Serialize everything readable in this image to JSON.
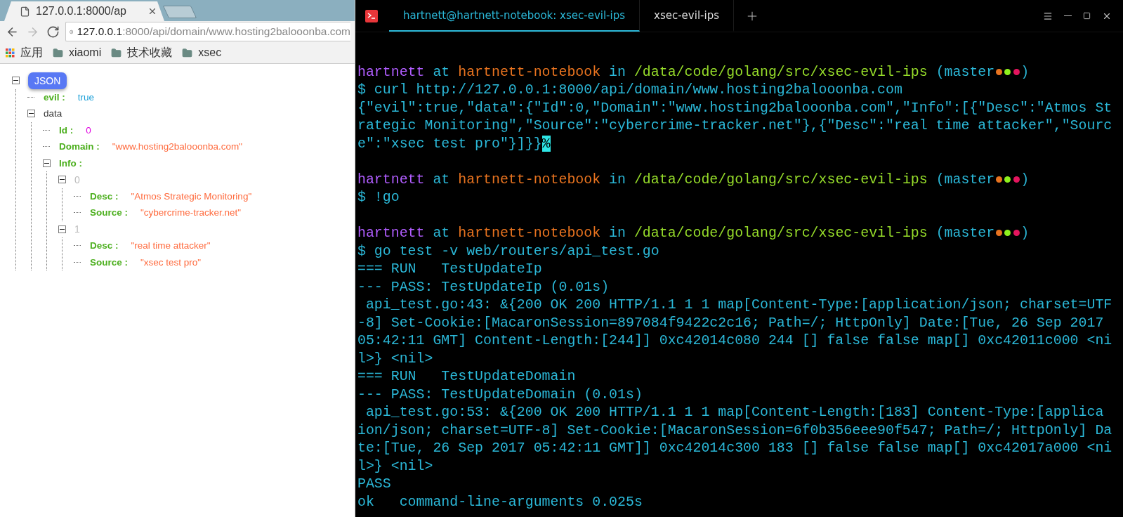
{
  "browser": {
    "tabs": [
      {
        "kind": "page",
        "title": "127.0.0.1:8000/ap",
        "selected": true
      },
      {
        "kind": "new",
        "selected": false
      }
    ],
    "nav_buttons": [
      {
        "kind": "back",
        "disabled": false
      },
      {
        "kind": "forward",
        "disabled": true
      },
      {
        "kind": "reload",
        "disabled": false
      }
    ],
    "address": {
      "host": "127.0.0.1",
      "rest": ":8000/api/domain/www.hosting2balooonba.com"
    },
    "bookmarks": [
      {
        "kind": "apps",
        "label": "应用"
      },
      {
        "kind": "folder",
        "label": "xiaomi"
      },
      {
        "kind": "folder",
        "label": "技术收藏"
      },
      {
        "kind": "folder",
        "label": "xsec"
      }
    ],
    "json_tree": {
      "label": "JSON",
      "expanded": true,
      "children": [
        {
          "kind": "boolean",
          "key": "evil :",
          "value": "true"
        },
        {
          "kind": "object",
          "key": "data",
          "expanded": true,
          "children": [
            {
              "kind": "number",
              "key": "Id :",
              "value": "0"
            },
            {
              "kind": "string",
              "key": "Domain :",
              "value": "\"www.hosting2balooonba.com\""
            },
            {
              "kind": "array",
              "key": "Info :",
              "expanded": true,
              "children": [
                {
                  "kind": "index",
                  "key": "0",
                  "expanded": true,
                  "children": [
                    {
                      "kind": "string",
                      "key": "Desc :",
                      "value": "\"Atmos Strategic Monitoring\""
                    },
                    {
                      "kind": "string",
                      "key": "Source :",
                      "value": "\"cybercrime-tracker.net\""
                    }
                  ]
                },
                {
                  "kind": "index",
                  "key": "1",
                  "expanded": true,
                  "children": [
                    {
                      "kind": "string",
                      "key": "Desc :",
                      "value": "\"real time attacker\""
                    },
                    {
                      "kind": "string",
                      "key": "Source :",
                      "value": "\"xsec test pro\""
                    }
                  ]
                }
              ]
            }
          ]
        }
      ]
    }
  },
  "terminal": {
    "tabs": [
      {
        "label": "hartnett@hartnett-notebook: xsec-evil-ips",
        "selected": true
      },
      {
        "label": "xsec-evil-ips",
        "selected": false
      }
    ],
    "lines": [
      {
        "kind": "blank"
      },
      {
        "kind": "text",
        "segments": [
          {
            "kind": "text",
            "text": "hartnett",
            "color": "#b15dff"
          },
          {
            "kind": "text",
            "text": " at ",
            "color": "#2bb8d8"
          },
          {
            "kind": "text",
            "text": "hartnett-notebook",
            "color": "#e8731f"
          },
          {
            "kind": "text",
            "text": " in ",
            "color": "#2bb8d8"
          },
          {
            "kind": "text",
            "text": "/data/code/golang/src/xsec-evil-ips",
            "color": "#96dc2a"
          },
          {
            "kind": "text",
            "text": " (master",
            "color": "#2bb8d8"
          },
          {
            "kind": "dot",
            "color": "#e8731f"
          },
          {
            "kind": "dot",
            "color": "#8ef01d"
          },
          {
            "kind": "dot",
            "color": "#e4155e"
          },
          {
            "kind": "text",
            "text": ")",
            "color": "#2bb8d8"
          }
        ]
      },
      {
        "kind": "text",
        "segments": [
          {
            "kind": "text",
            "text": "$ curl http://127.0.0.1:8000/api/domain/www.hosting2balooonba.com",
            "color": "#2bb8d8"
          }
        ]
      },
      {
        "kind": "text",
        "segments": [
          {
            "kind": "text",
            "text": "{\"evil\":true,\"data\":{\"Id\":0,\"Domain\":\"www.hosting2balooonba.com\",\"Info\":[{\"Desc\":\"Atmos St",
            "color": "#2bb8d8"
          }
        ]
      },
      {
        "kind": "text",
        "segments": [
          {
            "kind": "text",
            "text": "rategic Monitoring\",\"Source\":\"cybercrime-tracker.net\"},{\"Desc\":\"real time attacker\",\"Sourc",
            "color": "#2bb8d8"
          }
        ]
      },
      {
        "kind": "text",
        "segments": [
          {
            "kind": "text",
            "text": "e\":\"xsec test pro\"}]}}",
            "color": "#2bb8d8"
          },
          {
            "kind": "cursor",
            "text": "%",
            "color": "#2ee6e6"
          }
        ]
      },
      {
        "kind": "blank"
      },
      {
        "kind": "text",
        "segments": [
          {
            "kind": "text",
            "text": "hartnett",
            "color": "#b15dff"
          },
          {
            "kind": "text",
            "text": " at ",
            "color": "#2bb8d8"
          },
          {
            "kind": "text",
            "text": "hartnett-notebook",
            "color": "#e8731f"
          },
          {
            "kind": "text",
            "text": " in ",
            "color": "#2bb8d8"
          },
          {
            "kind": "text",
            "text": "/data/code/golang/src/xsec-evil-ips",
            "color": "#96dc2a"
          },
          {
            "kind": "text",
            "text": " (master",
            "color": "#2bb8d8"
          },
          {
            "kind": "dot",
            "color": "#e8731f"
          },
          {
            "kind": "dot",
            "color": "#8ef01d"
          },
          {
            "kind": "dot",
            "color": "#e4155e"
          },
          {
            "kind": "text",
            "text": ")",
            "color": "#2bb8d8"
          }
        ]
      },
      {
        "kind": "text",
        "segments": [
          {
            "kind": "text",
            "text": "$ !go",
            "color": "#2bb8d8"
          }
        ]
      },
      {
        "kind": "blank"
      },
      {
        "kind": "text",
        "segments": [
          {
            "kind": "text",
            "text": "hartnett",
            "color": "#b15dff"
          },
          {
            "kind": "text",
            "text": " at ",
            "color": "#2bb8d8"
          },
          {
            "kind": "text",
            "text": "hartnett-notebook",
            "color": "#e8731f"
          },
          {
            "kind": "text",
            "text": " in ",
            "color": "#2bb8d8"
          },
          {
            "kind": "text",
            "text": "/data/code/golang/src/xsec-evil-ips",
            "color": "#96dc2a"
          },
          {
            "kind": "text",
            "text": " (master",
            "color": "#2bb8d8"
          },
          {
            "kind": "dot",
            "color": "#e8731f"
          },
          {
            "kind": "dot",
            "color": "#8ef01d"
          },
          {
            "kind": "dot",
            "color": "#e4155e"
          },
          {
            "kind": "text",
            "text": ")",
            "color": "#2bb8d8"
          }
        ]
      },
      {
        "kind": "text",
        "segments": [
          {
            "kind": "text",
            "text": "$ go test -v web/routers/api_test.go",
            "color": "#2bb8d8"
          }
        ]
      },
      {
        "kind": "text",
        "segments": [
          {
            "kind": "text",
            "text": "=== RUN   TestUpdateIp",
            "color": "#2bb8d8"
          }
        ]
      },
      {
        "kind": "text",
        "segments": [
          {
            "kind": "text",
            "text": "--- PASS: TestUpdateIp (0.01s)",
            "color": "#2bb8d8"
          }
        ]
      },
      {
        "kind": "text",
        "segments": [
          {
            "kind": "text",
            "text": " api_test.go:43: &{200 OK 200 HTTP/1.1 1 1 map[Content-Type:[application/json; charset=UTF",
            "color": "#2bb8d8"
          }
        ]
      },
      {
        "kind": "text",
        "segments": [
          {
            "kind": "text",
            "text": "-8] Set-Cookie:[MacaronSession=897084f9422c2c16; Path=/; HttpOnly] Date:[Tue, 26 Sep 2017",
            "color": "#2bb8d8"
          }
        ]
      },
      {
        "kind": "text",
        "segments": [
          {
            "kind": "text",
            "text": "05:42:11 GMT] Content-Length:[244]] 0xc42014c080 244 [] false false map[] 0xc42011c000 <ni",
            "color": "#2bb8d8"
          }
        ]
      },
      {
        "kind": "text",
        "segments": [
          {
            "kind": "text",
            "text": "l>} <nil>",
            "color": "#2bb8d8"
          }
        ]
      },
      {
        "kind": "text",
        "segments": [
          {
            "kind": "text",
            "text": "=== RUN   TestUpdateDomain",
            "color": "#2bb8d8"
          }
        ]
      },
      {
        "kind": "text",
        "segments": [
          {
            "kind": "text",
            "text": "--- PASS: TestUpdateDomain (0.01s)",
            "color": "#2bb8d8"
          }
        ]
      },
      {
        "kind": "text",
        "segments": [
          {
            "kind": "text",
            "text": " api_test.go:53: &{200 OK 200 HTTP/1.1 1 1 map[Content-Length:[183] Content-Type:[applica",
            "color": "#2bb8d8"
          }
        ]
      },
      {
        "kind": "text",
        "segments": [
          {
            "kind": "text",
            "text": "ion/json; charset=UTF-8] Set-Cookie:[MacaronSession=6f0b356eee90f547; Path=/; HttpOnly] Da",
            "color": "#2bb8d8"
          }
        ]
      },
      {
        "kind": "text",
        "segments": [
          {
            "kind": "text",
            "text": "te:[Tue, 26 Sep 2017 05:42:11 GMT]] 0xc42014c300 183 [] false false map[] 0xc42017a000 <ni",
            "color": "#2bb8d8"
          }
        ]
      },
      {
        "kind": "text",
        "segments": [
          {
            "kind": "text",
            "text": "l>} <nil>",
            "color": "#2bb8d8"
          }
        ]
      },
      {
        "kind": "text",
        "segments": [
          {
            "kind": "text",
            "text": "PASS",
            "color": "#2bb8d8"
          }
        ]
      },
      {
        "kind": "text",
        "segments": [
          {
            "kind": "text",
            "text": "ok   command-line-arguments 0.025s",
            "color": "#2bb8d8"
          }
        ]
      }
    ]
  }
}
